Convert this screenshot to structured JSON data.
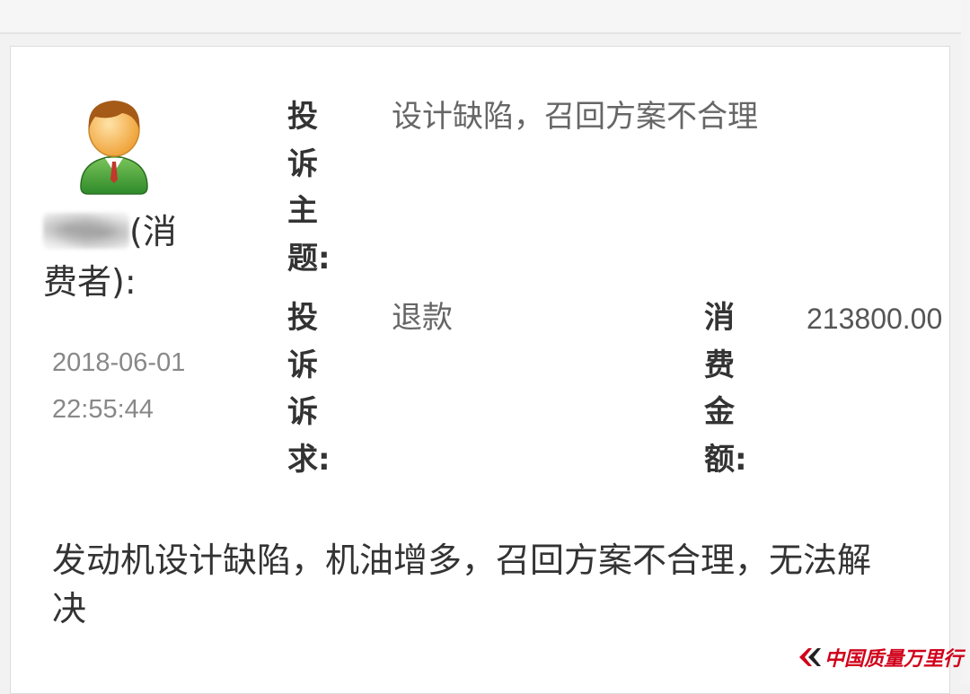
{
  "complaint": {
    "user_role": "(消费者):",
    "date": "2018-06-01",
    "time": "22:55:44",
    "subject_label": [
      "投",
      "诉",
      "主",
      "题:"
    ],
    "subject_value": "设计缺陷，召回方案不合理",
    "request_label": [
      "投",
      "诉",
      "诉",
      "求:"
    ],
    "request_value": "退款",
    "amount_label": [
      "消",
      "费",
      "金",
      "额:"
    ],
    "amount_value": "213800.00",
    "description": "发动机设计缺陷，机油增多，召回方案不合理，无法解决"
  },
  "watermark": {
    "text": "中国质量万里行",
    "color": "#d0021b"
  },
  "icons": {
    "avatar": "user-avatar-icon",
    "watermark_logo": "brand-logo-icon"
  }
}
